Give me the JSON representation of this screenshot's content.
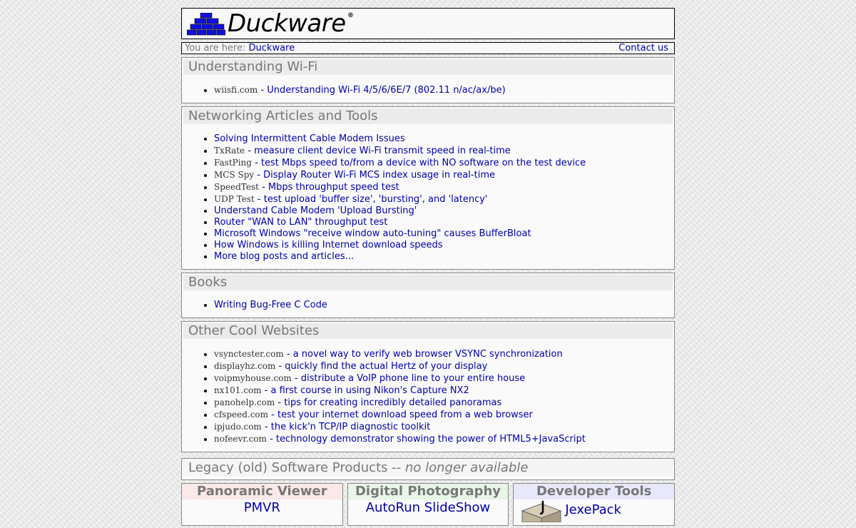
{
  "logo": {
    "text": "Duckware",
    "reg": "®"
  },
  "breadcrumb": {
    "prefix": "You are here:",
    "home": "Duckware",
    "contact": "Contact us"
  },
  "sections": {
    "wifi": {
      "title": "Understanding Wi-Fi",
      "items": [
        {
          "domain": "wiisfi.com",
          "text": "Understanding Wi-Fi 4/5/6/6E/7 (802.11 n/ac/ax/be)"
        }
      ]
    },
    "networking": {
      "title": "Networking Articles and Tools",
      "items": [
        {
          "domain": "",
          "text": "Solving Intermittent Cable Modem Issues"
        },
        {
          "domain": "TxRate",
          "text": "measure client device Wi-Fi transmit speed in real-time"
        },
        {
          "domain": "FastPing",
          "text": "test Mbps speed to/from a device with NO software on the test device"
        },
        {
          "domain": "MCS Spy",
          "text": "Display Router Wi-Fi MCS index usage in real-time"
        },
        {
          "domain": "SpeedTest",
          "text": "Mbps throughput speed test"
        },
        {
          "domain": "UDP Test",
          "text": "test upload 'buffer size', 'bursting', and 'latency'"
        },
        {
          "domain": "",
          "text": "Understand Cable Modem 'Upload Bursting'"
        },
        {
          "domain": "",
          "text": "Router \"WAN to LAN\" throughput test"
        },
        {
          "domain": "",
          "text": "Microsoft Windows \"receive window auto-tuning\" causes BufferBloat"
        },
        {
          "domain": "",
          "text": "How Windows is killing Internet download speeds"
        },
        {
          "domain": "",
          "text": "More blog posts and articles..."
        }
      ]
    },
    "books": {
      "title": "Books",
      "items": [
        {
          "domain": "",
          "text": "Writing Bug-Free C Code"
        }
      ]
    },
    "other": {
      "title": "Other Cool Websites",
      "items": [
        {
          "domain": "vsynctester.com",
          "text": "a novel way to verify web browser VSYNC synchronization"
        },
        {
          "domain": "displayhz.com",
          "text": "quickly find the actual Hertz of your display"
        },
        {
          "domain": "voipmyhouse.com",
          "text": "distribute a VoIP phone line to your entire house"
        },
        {
          "domain": "nx101.com",
          "text": "a first course in using Nikon's Capture NX2"
        },
        {
          "domain": "panohelp.com",
          "text": "tips for creating incredibly detailed panoramas"
        },
        {
          "domain": "cfspeed.com",
          "text": "test your internet download speed from a web browser"
        },
        {
          "domain": "ipjudo.com",
          "text": "the kick'n TCP/IP diagnostic toolkit"
        },
        {
          "domain": "nofeevr.com",
          "text": "technology demonstrator showing the power of HTML5+JavaScript"
        }
      ]
    },
    "legacy": {
      "title_main": "Legacy (old) Software Products --",
      "title_italic": "no longer available",
      "columns": [
        {
          "head": "Panoramic Viewer",
          "link": "PMVR"
        },
        {
          "head": "Digital Photography",
          "link": "AutoRun SlideShow"
        },
        {
          "head": "Developer Tools",
          "link": "JexePack"
        }
      ]
    }
  }
}
